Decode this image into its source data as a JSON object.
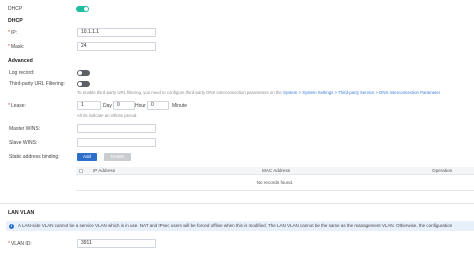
{
  "dhcp_toggle": {
    "label": "DHCP",
    "on": true
  },
  "dhcp_section": {
    "title": "DHCP"
  },
  "ip": {
    "label": "IP:",
    "value": "10.1.1.1"
  },
  "mask": {
    "label": "Mask:",
    "value": "24"
  },
  "advanced": {
    "title": "Advanced",
    "log_record": {
      "label": "Log record:",
      "on": false
    },
    "url_filtering": {
      "label": "Third-party URL Filtering:",
      "on": false
    },
    "hint_prefix": "To enable third-party URL filtering, you need to configure third-party DNS interconnection parameters on the",
    "hint_link": "System > System Settings > Third-party Service > DNS Interconnection Parameter"
  },
  "lease": {
    "label": "Lease:",
    "days": "1",
    "days_unit": "Day",
    "hours": "0",
    "hours_unit": "Hour",
    "minutes": "0",
    "minutes_unit": "Minute",
    "hint": "All 0s indicate an infinite period."
  },
  "master_wins": {
    "label": "Master WINS:",
    "value": ""
  },
  "slave_wins": {
    "label": "Slave WINS:",
    "value": ""
  },
  "static_binding": {
    "label": "Static address binding:",
    "add_label": "Add",
    "delete_label": "Delete",
    "columns": [
      "IP Address",
      "MAC Address",
      "Operation"
    ],
    "empty_text": "No records found."
  },
  "lan_vlan": {
    "title": "LAN VLAN",
    "notice": "A LAN-side VLAN cannot be a service VLAN which is in use. NAT and IPsec users will be forced offline when this is modified. The LAN VLAN cannot be the same as the management VLAN. Otherwise, the configuration",
    "vlan_id_label": "VLAN ID:",
    "vlan_id_value": "3911"
  },
  "colors": {
    "accent": "#1fbf9f",
    "primary": "#2c6ec9",
    "required": "#e03a3a",
    "link": "#3b7bd8"
  }
}
